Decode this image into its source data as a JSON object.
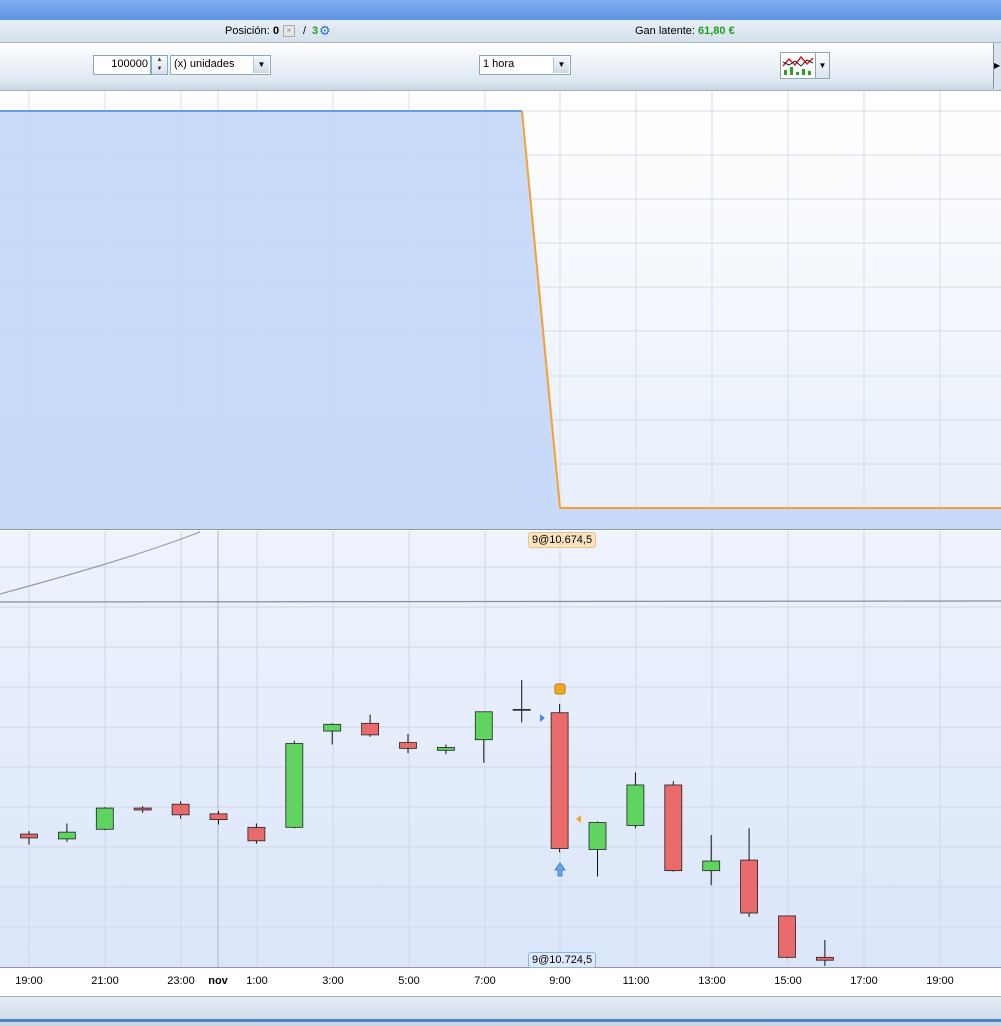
{
  "status": {
    "position_label": "Posición:",
    "position_value": "0",
    "separator": "/",
    "orders_count": "3",
    "latent_label": "Gan latente:",
    "latent_value": "61,80 €"
  },
  "toolbar": {
    "quantity_value": "100000",
    "quantity_unit": "(x) unidades",
    "timeframe": "1 hora",
    "chart_type_icon": "indicator-chart-icon"
  },
  "trade_tags": {
    "top": "9@10.674,5",
    "bottom": "9@10.724,5"
  },
  "x_axis": {
    "labels": [
      "19:00",
      "21:00",
      "23:00",
      "nov",
      "1:00",
      "3:00",
      "5:00",
      "7:00",
      "9:00",
      "11:00",
      "13:00",
      "15:00",
      "17:00",
      "19:00"
    ]
  },
  "colors": {
    "bull": "#5fd55f",
    "bear": "#e96a6a",
    "equity_fill": "#c4d7fa",
    "drawdown_line": "#f5a030",
    "accent_green": "#1e9e1e",
    "accent_blue": "#2f6fd0"
  },
  "chart_data": {
    "type": "candlestick",
    "x": [
      "19:00",
      "20:00",
      "21:00",
      "22:00",
      "23:00",
      "0:00",
      "1:00",
      "2:00",
      "3:00",
      "4:00",
      "5:00",
      "6:00",
      "7:00",
      "8:00",
      "9:00",
      "10:00",
      "11:00",
      "12:00",
      "13:00",
      "14:00",
      "15:00",
      "16:00"
    ],
    "series": [
      {
        "open": 10738.5,
        "high": 10740,
        "low": 10733,
        "close": 10736.5
      },
      {
        "open": 10736,
        "high": 10744,
        "low": 10734.5,
        "close": 10739.5
      },
      {
        "open": 10741,
        "high": 10752.5,
        "low": 10740.5,
        "close": 10752
      },
      {
        "open": 10752,
        "high": 10753,
        "low": 10749.5,
        "close": 10751
      },
      {
        "open": 10754,
        "high": 10755.5,
        "low": 10746.5,
        "close": 10748.5
      },
      {
        "open": 10749,
        "high": 10750.5,
        "low": 10743.5,
        "close": 10746
      },
      {
        "open": 10742,
        "high": 10744,
        "low": 10733.5,
        "close": 10735
      },
      {
        "open": 10742,
        "high": 10787,
        "low": 10741.5,
        "close": 10785.5
      },
      {
        "open": 10792,
        "high": 10796,
        "low": 10785,
        "close": 10795.5
      },
      {
        "open": 10796,
        "high": 10800.5,
        "low": 10789,
        "close": 10790
      },
      {
        "open": 10786,
        "high": 10790.5,
        "low": 10780.5,
        "close": 10783
      },
      {
        "open": 10782,
        "high": 10785,
        "low": 10780,
        "close": 10783.5
      },
      {
        "open": 10787.5,
        "high": 10802,
        "low": 10775.5,
        "close": 10802
      },
      {
        "open": 10803,
        "high": 10818.5,
        "low": 10796.5,
        "close": 10803
      },
      {
        "open": 10801.5,
        "high": 10806,
        "low": 10729,
        "close": 10731
      },
      {
        "open": 10730.5,
        "high": 10745,
        "low": 10716.5,
        "close": 10744.5
      },
      {
        "open": 10743,
        "high": 10770.5,
        "low": 10741.5,
        "close": 10764
      },
      {
        "open": 10764,
        "high": 10766,
        "low": 10719,
        "close": 10719.5
      },
      {
        "open": 10719.5,
        "high": 10738,
        "low": 10712,
        "close": 10724.5
      },
      {
        "open": 10725,
        "high": 10741.5,
        "low": 10695.5,
        "close": 10697.5
      },
      {
        "open": 10696,
        "high": 10692.5,
        "low": 10674,
        "close": 10674.5
      },
      {
        "open": 10674.5,
        "high": 10683.5,
        "low": 10670,
        "close": 10673
      }
    ],
    "equity_curve": {
      "x": [
        "19:00",
        "8:00",
        "9:00",
        "19:00"
      ],
      "levels": [
        "high",
        "high",
        "low",
        "low"
      ]
    },
    "markers": [
      "entry-short-9:00",
      "exit-9:00"
    ]
  }
}
